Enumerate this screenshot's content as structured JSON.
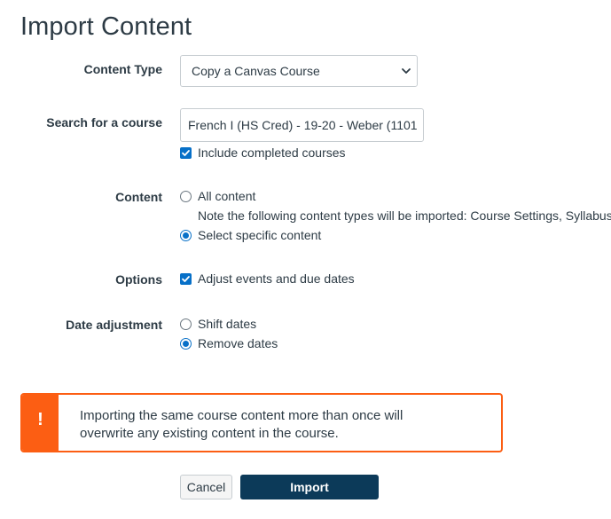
{
  "page": {
    "title": "Import Content"
  },
  "form": {
    "content_type": {
      "label": "Content Type",
      "selected": "Copy a Canvas Course"
    },
    "search_course": {
      "label": "Search for a course",
      "value": "French I (HS Cred) - 19-20 - Weber (1101",
      "include_completed_label": "Include completed courses",
      "include_completed_checked": true
    },
    "content": {
      "label": "Content",
      "all_content_label": "All content",
      "note": "Note the following content types will be imported: Course Settings, Syllabus",
      "select_specific_label": "Select specific content",
      "selected": "select_specific"
    },
    "options": {
      "label": "Options",
      "adjust_events_label": "Adjust events and due dates",
      "adjust_events_checked": true
    },
    "date_adjustment": {
      "label": "Date adjustment",
      "shift_label": "Shift dates",
      "remove_label": "Remove dates",
      "selected": "remove"
    }
  },
  "alert": {
    "icon": "!",
    "line1": "Importing the same course content more than once will",
    "line2": "overwrite any existing content in the course.",
    "color": "#fc5e13"
  },
  "buttons": {
    "cancel": "Cancel",
    "import": "Import"
  },
  "colors": {
    "accent": "#0770c8",
    "primary_button": "#0c3a59",
    "warning": "#fc5e13"
  }
}
